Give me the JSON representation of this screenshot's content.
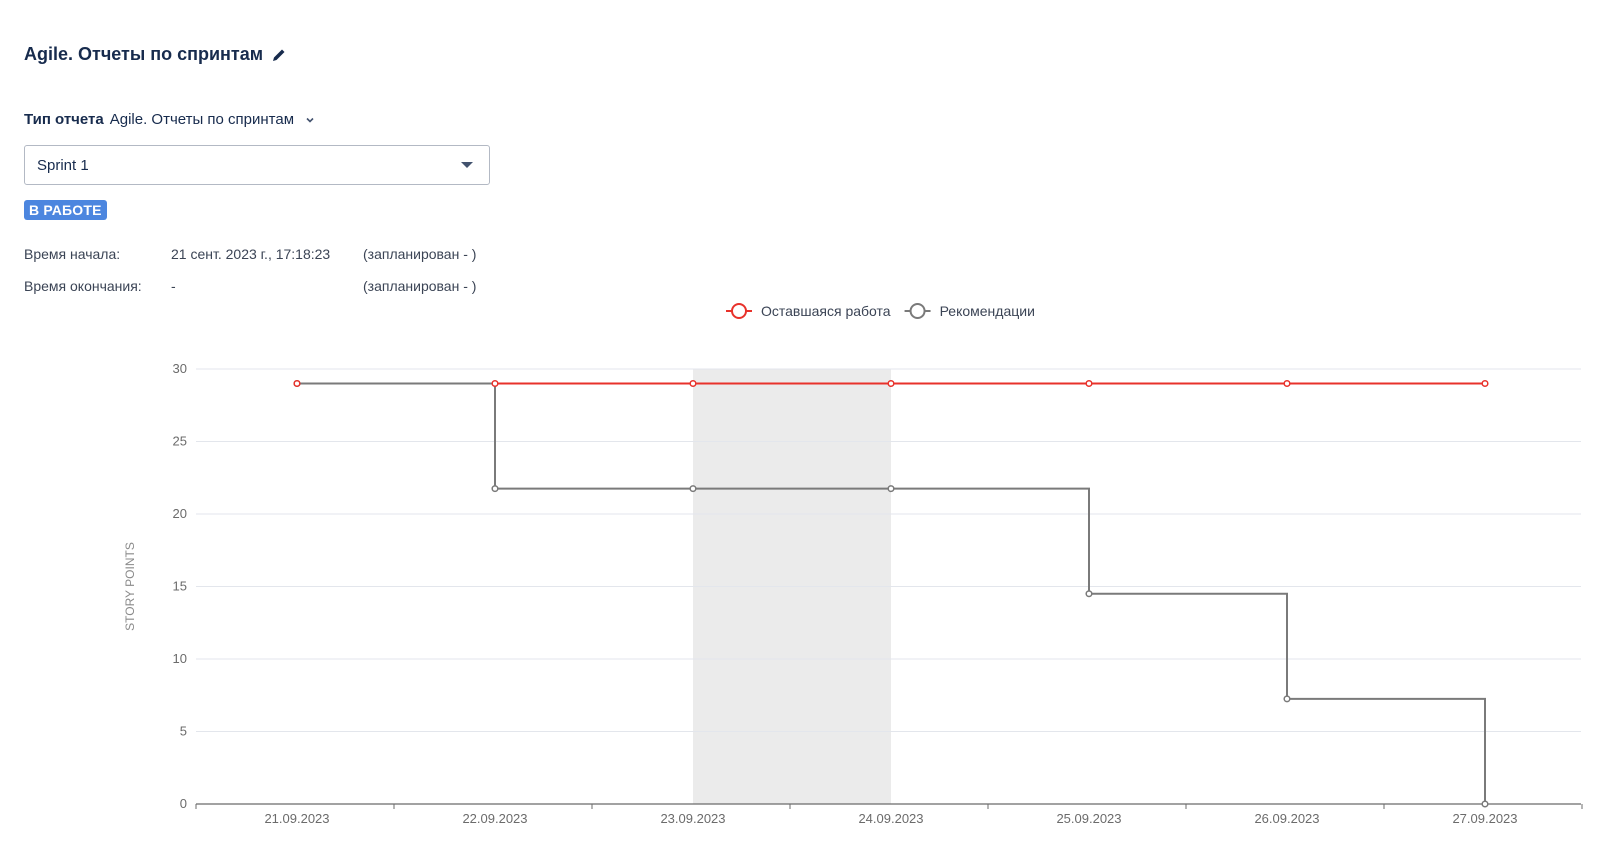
{
  "page": {
    "title": "Agile. Отчеты по спринтам",
    "edit_icon": "pencil-icon"
  },
  "report_type": {
    "label": "Тип отчета",
    "value": "Agile. Отчеты по спринтам",
    "icon": "chevron-down-icon"
  },
  "sprint_select": {
    "value": "Sprint 1",
    "icon": "caret-down-icon"
  },
  "status": {
    "label": "В РАБОТЕ",
    "color": "#4c86df"
  },
  "times": {
    "start_label": "Время начала:",
    "start_value": "21 сент. 2023 г., 17:18:23",
    "start_planned": "(запланирован - )",
    "end_label": "Время окончания:",
    "end_value": "-",
    "end_planned": "(запланирован - )"
  },
  "chart_data": {
    "type": "line",
    "step": true,
    "ylabel": "STORY POINTS",
    "xlabel": "",
    "ylim": [
      0,
      30
    ],
    "yticks": [
      0,
      5,
      10,
      15,
      20,
      25,
      30
    ],
    "categories": [
      "21.09.2023",
      "22.09.2023",
      "23.09.2023",
      "24.09.2023",
      "25.09.2023",
      "26.09.2023",
      "27.09.2023"
    ],
    "non_working_range": [
      "23.09.2023",
      "24.09.2023"
    ],
    "grid": true,
    "legend_position": "top-center",
    "series": [
      {
        "name": "Оставшаяся работа",
        "color": "#e8322b",
        "values": [
          29,
          29,
          29,
          29,
          29,
          29,
          29
        ]
      },
      {
        "name": "Рекомендации",
        "color": "#7a7a7a",
        "values": [
          29,
          21.75,
          21.75,
          21.75,
          14.5,
          7.25,
          0
        ]
      }
    ]
  }
}
